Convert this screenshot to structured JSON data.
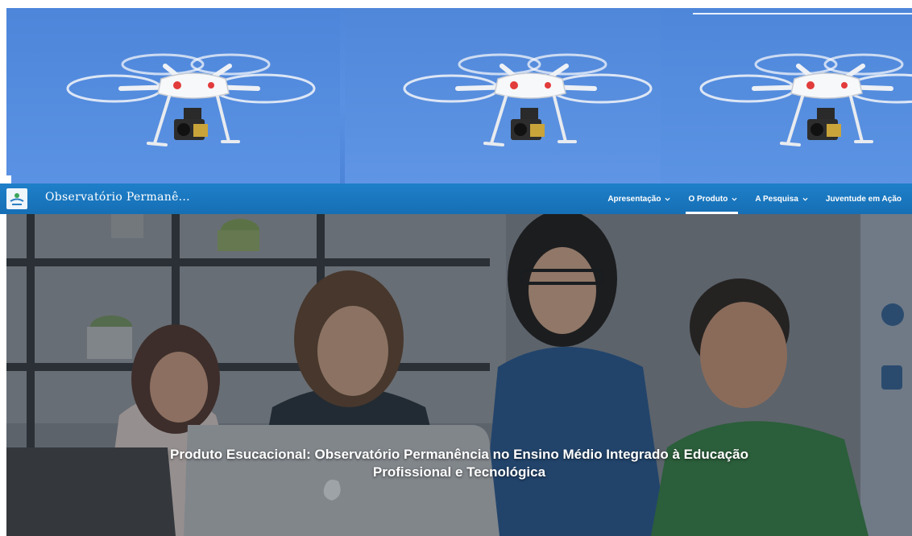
{
  "site": {
    "title": "Observatório Permanê..."
  },
  "nav": {
    "items": [
      {
        "label": "Apresentação",
        "active": false
      },
      {
        "label": "O Produto",
        "active": true
      },
      {
        "label": "A Pesquisa",
        "active": false
      },
      {
        "label": "Juventude em Ação",
        "active": false
      }
    ]
  },
  "hero": {
    "title_line1": "Produto Esucacional: Observatório Permanência no Ensino Médio Integrado à Educação",
    "title_line2": "Profissional e Tecnológica"
  },
  "colors": {
    "banner_sky": "#5b91e2",
    "nav_bar": "#1e7fc9",
    "nav_text": "#ffffff",
    "hero_overlay": "#3c4650"
  },
  "icons": {
    "logo": "site-logo-icon",
    "nav_chevron": "chevron-down-icon",
    "drone": "drone-image"
  }
}
